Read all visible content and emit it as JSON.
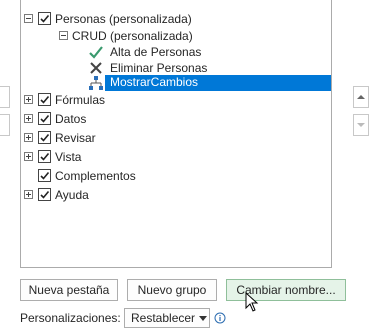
{
  "tree": {
    "personas": {
      "label": "Personas (personalizada)",
      "expanded": true,
      "checked": true
    },
    "crud": {
      "label": "CRUD (personalizada)",
      "expanded": true
    },
    "commands": [
      {
        "label": "Alta de Personas",
        "icon": "green-check-icon"
      },
      {
        "label": "Eliminar Personas",
        "icon": "cross-x-icon"
      },
      {
        "label": "MostrarCambios",
        "icon": "sitemap-icon",
        "selected": true
      }
    ],
    "tabs": [
      {
        "label": "Fórmulas",
        "expander": true
      },
      {
        "label": "Datos",
        "expander": true
      },
      {
        "label": "Revisar",
        "expander": true
      },
      {
        "label": "Vista",
        "expander": true
      },
      {
        "label": "Complementos",
        "expander": false
      },
      {
        "label": "Ayuda",
        "expander": true
      }
    ]
  },
  "buttons": {
    "new_tab": "Nueva pestaña",
    "new_group": "Nuevo grupo",
    "rename": "Cambiar nombre..."
  },
  "customizations": {
    "label": "Personalizaciones:",
    "reset": "Restablecer",
    "info_icon": "info-icon"
  },
  "colors": {
    "selection": "#0078d7",
    "check_green": "#2e8b57",
    "hover_button": "#e5f3e8"
  }
}
